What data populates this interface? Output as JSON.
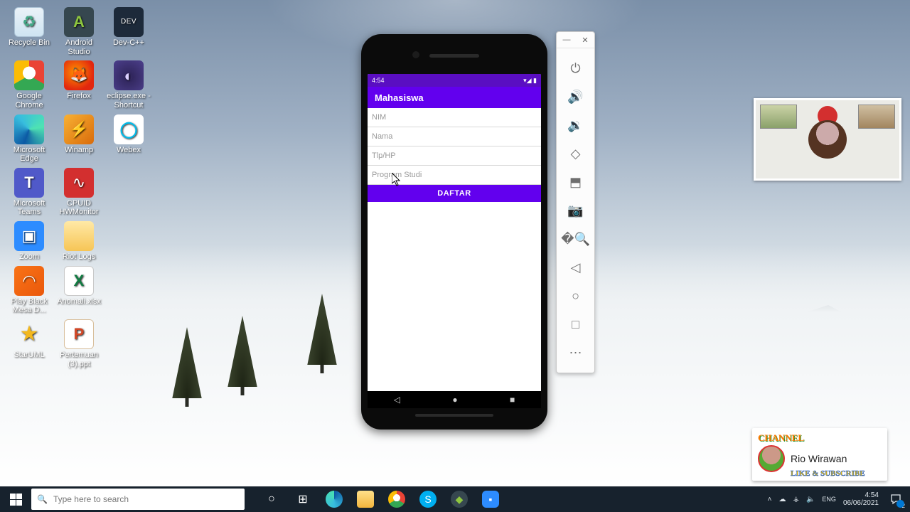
{
  "desktop": {
    "icons": [
      [
        {
          "label": "Recycle Bin",
          "c": "c-recycle"
        },
        {
          "label": "Android Studio",
          "c": "c-as"
        },
        {
          "label": "Dev-C++",
          "c": "c-dev"
        }
      ],
      [
        {
          "label": "Google Chrome",
          "c": "c-chrome"
        },
        {
          "label": "Firefox",
          "c": "c-ff"
        },
        {
          "label": "eclipse.exe - Shortcut",
          "c": "c-ecl"
        }
      ],
      [
        {
          "label": "Microsoft Edge",
          "c": "c-edge"
        },
        {
          "label": "Winamp",
          "c": "c-wmp"
        },
        {
          "label": "Webex",
          "c": "c-wbx"
        }
      ],
      [
        {
          "label": "Microsoft Teams",
          "c": "c-teams"
        },
        {
          "label": "CPUID HWMonitor",
          "c": "c-hw"
        }
      ],
      [
        {
          "label": "Zoom",
          "c": "c-zoom"
        },
        {
          "label": "Riot Logs",
          "c": "c-folder"
        }
      ],
      [
        {
          "label": "Play Black Mesa D...",
          "c": "c-pbm"
        },
        {
          "label": "Anomali.xlsx",
          "c": "c-xls"
        }
      ],
      [
        {
          "label": "StarUML",
          "c": "c-star"
        },
        {
          "label": "Pertemuan (3).ppt",
          "c": "c-ppt"
        }
      ]
    ]
  },
  "phone": {
    "status_time": "4:54",
    "status_icons": "✦ ⚙ ▮",
    "signal_icons": "▾◢ ▮",
    "app_title": "Mahasiswa",
    "fields": {
      "nim": "NIM",
      "nama": "Nama",
      "tlp": "Tlp/HP",
      "prodi": "Program Studi"
    },
    "button": "DAFTAR",
    "soft_back": "◁",
    "soft_home": "●",
    "soft_recent": "■"
  },
  "emuctl": {
    "min": "—",
    "close": "✕",
    "buttons": [
      "⏻",
      "🔊",
      "🔉",
      "◇",
      "⬒",
      "📷",
      "�🔍",
      "◁",
      "○",
      "□",
      "⋯"
    ]
  },
  "channel": {
    "tag": "CHANNEL",
    "name": "Rio Wirawan",
    "sub": "LIKE & SUBSCRIBE"
  },
  "taskbar": {
    "search_placeholder": "Type here to search",
    "time": "4:54",
    "date": "06/06/2021",
    "notif_count": "2"
  }
}
